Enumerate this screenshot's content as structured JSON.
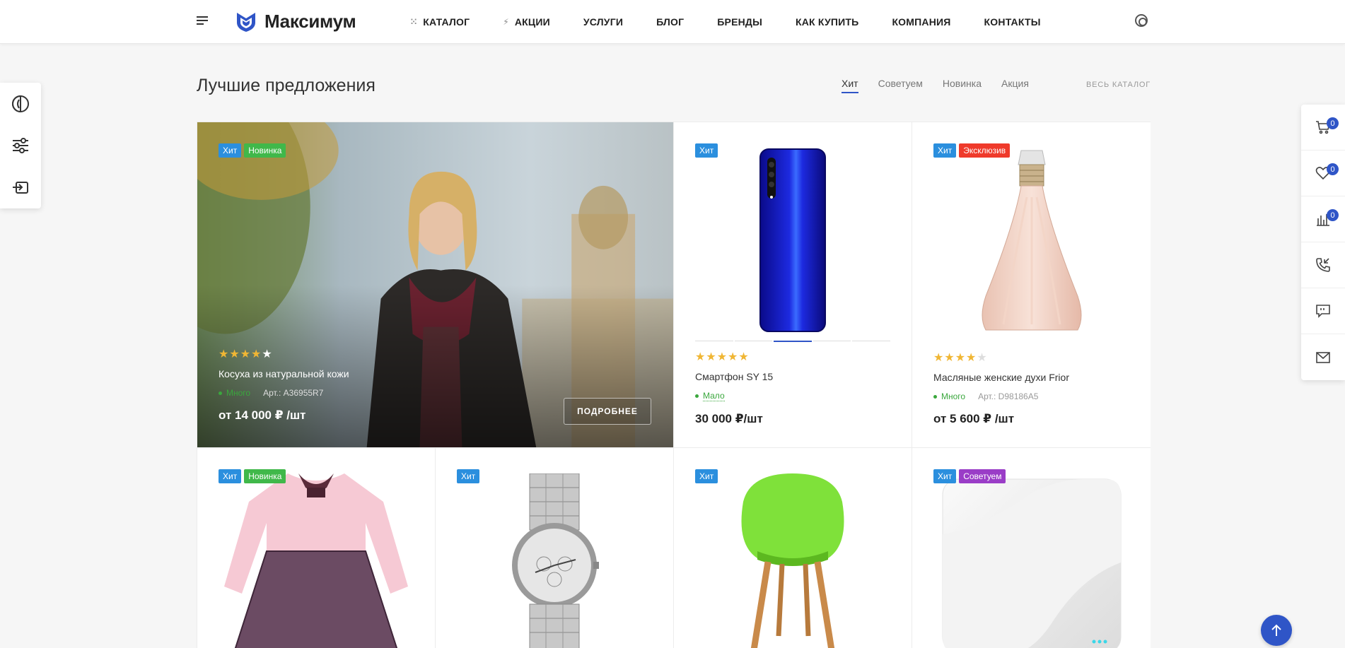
{
  "header": {
    "logo_text": "Максимум",
    "nav": [
      {
        "label": "КАТАЛОГ",
        "icon": "grid-dots-icon"
      },
      {
        "label": "АКЦИИ",
        "icon": "lightning-icon"
      },
      {
        "label": "УСЛУГИ"
      },
      {
        "label": "БЛОГ"
      },
      {
        "label": "БРЕНДЫ"
      },
      {
        "label": "КАК КУПИТЬ"
      },
      {
        "label": "КОМПАНИЯ"
      },
      {
        "label": "КОНТАКТЫ"
      }
    ]
  },
  "section": {
    "title": "Лучшие предложения",
    "tabs": [
      "Хит",
      "Советуем",
      "Новинка",
      "Акция"
    ],
    "active_tab": "Хит",
    "all_catalog": "ВЕСЬ КАТАЛОГ"
  },
  "right_panel": {
    "cart_count": "0",
    "favorites_count": "0",
    "compare_count": "0"
  },
  "products": {
    "hero": {
      "badges": [
        "Хит",
        "Новинка"
      ],
      "rating": 4,
      "name": "Косуха из натуральной кожи",
      "stock": "Много",
      "article": "Арт.: A36955R7",
      "price": "от 14 000 ₽ /шт",
      "more_button": "ПОДРОБНЕЕ"
    },
    "phone": {
      "badges": [
        "Хит"
      ],
      "rating": 5,
      "name": "Смартфон SY 15",
      "stock": "Мало",
      "price": "30 000 ₽/шт"
    },
    "perfume": {
      "badges": [
        "Хит",
        "Эксклюзив"
      ],
      "rating": 4,
      "name": "Масляные женские духи Frior",
      "stock": "Много",
      "article": "Арт.: D98186A5",
      "price": "от 5 600 ₽ /шт"
    },
    "dress": {
      "badges": [
        "Хит",
        "Новинка"
      ]
    },
    "watch": {
      "badges": [
        "Хит"
      ]
    },
    "chair": {
      "badges": [
        "Хит"
      ]
    },
    "device": {
      "badges": [
        "Хит",
        "Советуем"
      ]
    }
  },
  "colors": {
    "accent": "#2f55c7",
    "hit": "#2b8fde",
    "new": "#40b84a",
    "exclusive": "#ef3a2b",
    "advise": "#9a3dc7",
    "star": "#f0b634"
  }
}
